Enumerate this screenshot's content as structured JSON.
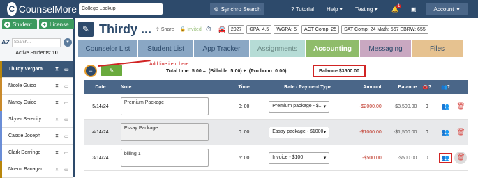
{
  "app": {
    "brand": "CounselMore",
    "college_lookup_placeholder": "College Lookup",
    "synchro_label": "Synchro Search",
    "nav_tutorial": "Tutorial",
    "nav_help": "Help",
    "nav_testing": "Testing",
    "notif_count": "1",
    "account_label": "Account"
  },
  "sidebar": {
    "student_btn": "Student",
    "license_btn": "License",
    "sort_label": "AZ",
    "search_placeholder": "Search...",
    "active_label": "Active Students:",
    "active_count": "10",
    "students": [
      {
        "name": "Thirdy Vergara",
        "color": "#b8860b"
      },
      {
        "name": "Nicole Guico",
        "color": "#c98a2c"
      },
      {
        "name": "Nancy Guico",
        "color": "#c98a2c"
      },
      {
        "name": "Skyler Serenity",
        "color": "#6a8dd6"
      },
      {
        "name": "Cassie Joseph",
        "color": "#6a8dd6"
      },
      {
        "name": "Clark Domingo",
        "color": "#6a8dd6"
      },
      {
        "name": "Noemi Banagan",
        "color": "#b8860b"
      }
    ]
  },
  "student": {
    "name": "Thirdy ...",
    "share": "Share",
    "invited": "Invited",
    "year": "2027",
    "gpa": "GPA: 4.5",
    "wgpa": "WGPA: 5",
    "act": "ACT Comp: 25",
    "sat": "SAT  Comp: 24  Math: 567  EBRW: 655"
  },
  "tabs": [
    "Counselor List",
    "Student List",
    "App Tracker",
    "Assignments",
    "Accounting",
    "Messaging",
    "Files"
  ],
  "toolbar": {
    "annotation": "Add line item here.",
    "total_time": "Total time:  5:00  =",
    "billable": "(Billable:  5:00)  +",
    "probono": "(Pro bono:   0:00)",
    "balance": "Balance  $3500.00"
  },
  "table": {
    "headers": {
      "date": "Date",
      "note": "Note",
      "time": "Time",
      "rate": "Rate / Payment Type",
      "amount": "Amount",
      "balance": "Balance"
    },
    "rows": [
      {
        "date": "5/14/24",
        "note": "Premium Package",
        "time": "0: 00",
        "rate": "Premium package - $...",
        "amount": "-$2000.00",
        "balance": "-$3,500.00",
        "count": "0"
      },
      {
        "date": "4/14/24",
        "note": "Essay Package",
        "time": "0: 00",
        "rate": "Essay package - $1000",
        "amount": "-$1000.00",
        "balance": "-$1,500.00",
        "count": "0"
      },
      {
        "date": "3/14/24",
        "note": "billing 1",
        "time": "5: 00",
        "rate": "Invoice - $100",
        "amount": "-$500.00",
        "balance": "-$500.00",
        "count": "0"
      }
    ]
  }
}
